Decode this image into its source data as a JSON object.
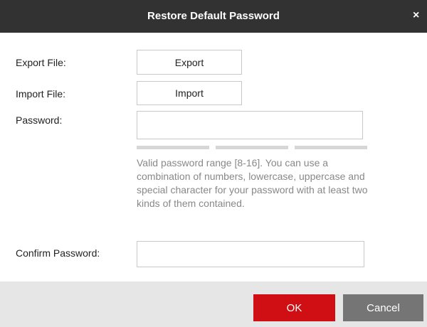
{
  "dialog": {
    "title": "Restore Default Password",
    "close_glyph": "×",
    "close_icon": "close-icon"
  },
  "form": {
    "export_label": "Export File:",
    "export_button": "Export",
    "import_label": "Import File:",
    "import_button": "Import",
    "password_label": "Password:",
    "password_value": "",
    "password_strength_level": 0,
    "password_hint": "Valid password range [8-16]. You can use a combination of numbers, lowercase, uppercase and special character for your password with at least two kinds of them contained.",
    "confirm_label": "Confirm Password:",
    "confirm_value": ""
  },
  "footer": {
    "ok_label": "OK",
    "cancel_label": "Cancel"
  },
  "colors": {
    "titlebar": "#323232",
    "ok_button": "#d00f15",
    "cancel_button": "#757575",
    "footer_bg": "#e6e6e6",
    "strength_empty": "#d6d6d6"
  }
}
